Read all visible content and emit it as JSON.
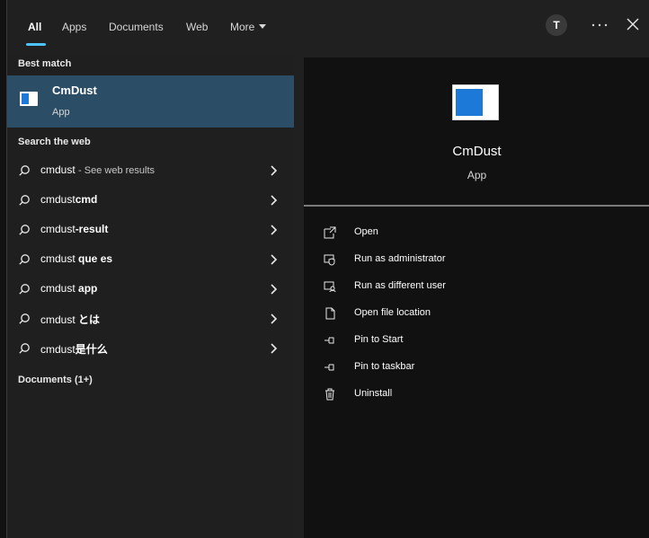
{
  "tabs": [
    {
      "label": "All"
    },
    {
      "label": "Apps"
    },
    {
      "label": "Documents"
    },
    {
      "label": "Web"
    },
    {
      "label": "More"
    }
  ],
  "user_initial": "T",
  "left": {
    "best_match_title": "Best match",
    "best_match_name": "CmDust",
    "best_match_type": "App",
    "search_web_title": "Search the web",
    "documents_title": "Documents (1+)",
    "search_rows": [
      {
        "prefix": "cmdust",
        "suffix": "- See web results",
        "style": "muted"
      },
      {
        "prefix": "cmdust",
        "suffix": "cmd",
        "style": "bold"
      },
      {
        "prefix": "cmdust",
        "suffix": "-result",
        "style": "bold"
      },
      {
        "prefix": "cmdust",
        "suffix": " que es",
        "style": "bold"
      },
      {
        "prefix": "cmdust",
        "suffix": " app",
        "style": "bold"
      },
      {
        "prefix": "cmdust",
        "suffix": " とは",
        "style": "bold"
      },
      {
        "prefix": "cmdust",
        "suffix": "是什么",
        "style": "bold"
      }
    ]
  },
  "right": {
    "app_name": "CmDust",
    "app_type": "App",
    "actions": [
      {
        "label": "Open",
        "icon": "open-icon"
      },
      {
        "label": "Run as administrator",
        "icon": "admin-shield-icon"
      },
      {
        "label": "Run as different user",
        "icon": "different-user-icon"
      },
      {
        "label": "Open file location",
        "icon": "file-location-icon"
      },
      {
        "label": "Pin to Start",
        "icon": "pin-icon"
      },
      {
        "label": "Pin to taskbar",
        "icon": "pin-icon"
      },
      {
        "label": "Uninstall",
        "icon": "trash-icon"
      }
    ]
  },
  "colors": {
    "accent": "#4cc2ff",
    "selected": "#2b4d66",
    "bg": "#202020",
    "right_bg": "#111111"
  }
}
